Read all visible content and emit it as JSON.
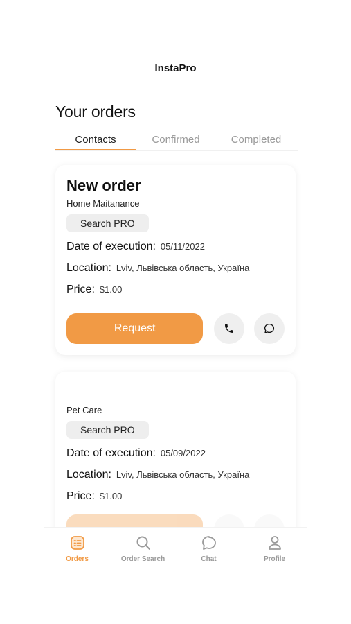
{
  "app": {
    "title": "InstaPro"
  },
  "page": {
    "title": "Your orders"
  },
  "tabs": [
    {
      "label": "Contacts",
      "active": true
    },
    {
      "label": "Confirmed",
      "active": false
    },
    {
      "label": "Completed",
      "active": false
    }
  ],
  "orders": [
    {
      "title": "New order",
      "category": "Home Maitanance",
      "badge": "Search PRO",
      "date_label": "Date of execution:",
      "date_value": "05/11/2022",
      "location_label": "Location:",
      "location_value": "Lviv, Львівська область, Україна",
      "price_label": "Price:",
      "price_value": "$1.00",
      "request_label": "Request"
    },
    {
      "title": "",
      "category": "Pet Care",
      "badge": "Search PRO",
      "date_label": "Date of execution:",
      "date_value": "05/09/2022",
      "location_label": "Location:",
      "location_value": "Lviv, Львівська область, Україна",
      "price_label": "Price:",
      "price_value": "$1.00",
      "request_label": ""
    }
  ],
  "nav": [
    {
      "label": "Orders",
      "icon": "orders-icon",
      "active": true
    },
    {
      "label": "Order Search",
      "icon": "search-icon",
      "active": false
    },
    {
      "label": "Chat",
      "icon": "chat-icon",
      "active": false
    },
    {
      "label": "Profile",
      "icon": "profile-icon",
      "active": false
    }
  ],
  "colors": {
    "accent": "#f19a45",
    "muted": "#9a9a9a",
    "badge_bg": "#eeeeee"
  }
}
